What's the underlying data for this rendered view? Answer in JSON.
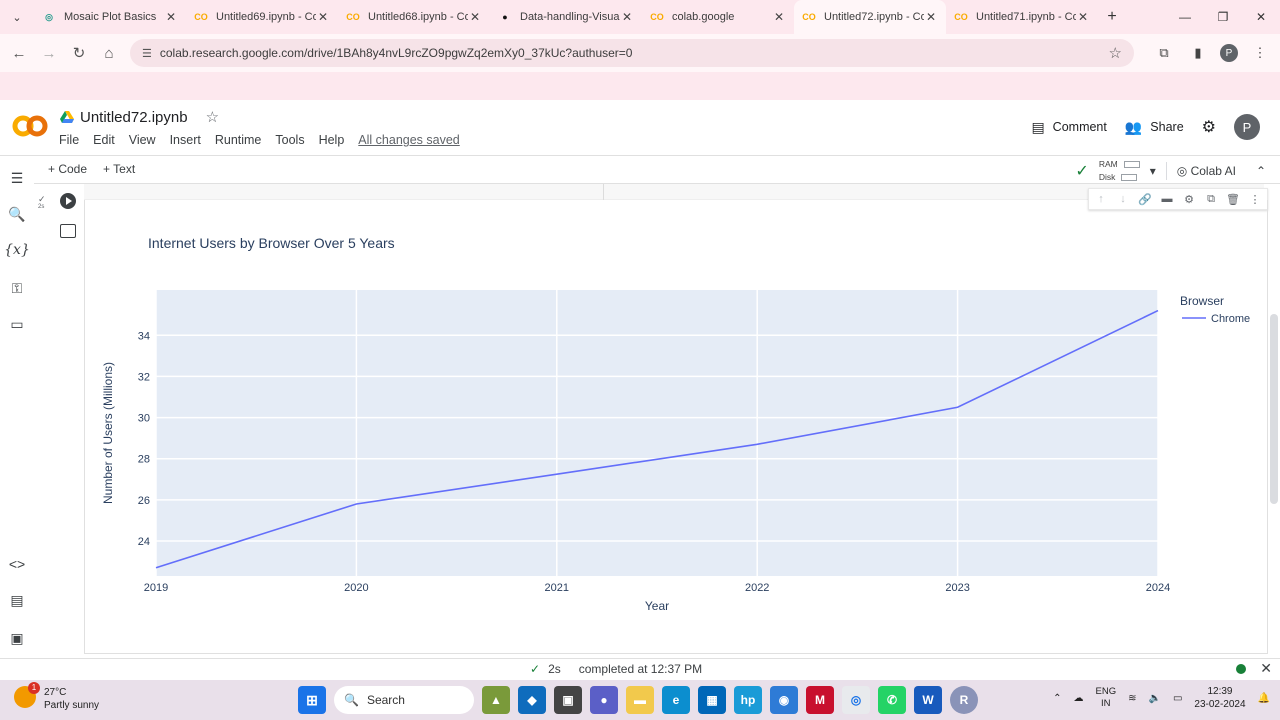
{
  "browser": {
    "tabs": [
      {
        "title": "Mosaic Plot Basics",
        "fav": "mosaic-icon",
        "active": false
      },
      {
        "title": "Untitled69.ipynb - Co",
        "fav": "colab-icon",
        "active": false
      },
      {
        "title": "Untitled68.ipynb - Co",
        "fav": "colab-icon",
        "active": false
      },
      {
        "title": "Data-handling-Visua",
        "fav": "github-icon",
        "active": false
      },
      {
        "title": "colab.google",
        "fav": "colab-icon",
        "active": false
      },
      {
        "title": "Untitled72.ipynb - Co",
        "fav": "colab-icon",
        "active": true
      },
      {
        "title": "Untitled71.ipynb - Co",
        "fav": "colab-icon",
        "active": false
      }
    ],
    "url": "colab.research.google.com/drive/1BAh8y4nvL9rcZO9pgwZq2emXy0_37kUc?authuser=0",
    "profile_initial": "P"
  },
  "colab": {
    "title": "Untitled72.ipynb",
    "menu": [
      "File",
      "Edit",
      "View",
      "Insert",
      "Runtime",
      "Tools",
      "Help"
    ],
    "saved_status": "All changes saved",
    "comment_label": "Comment",
    "share_label": "Share",
    "avatar_initial": "P",
    "toolbar": {
      "code_label": "+ Code",
      "text_label": "+ Text",
      "ram_label": "RAM",
      "disk_label": "Disk",
      "colab_ai_label": "Colab AI"
    },
    "cell_status": {
      "check": "✓",
      "time": "2s"
    }
  },
  "chart_data": {
    "type": "line",
    "title": "Internet Users by Browser Over 5 Years",
    "xlabel": "Year",
    "ylabel": "Number of Users (Millions)",
    "x": [
      2019,
      2020,
      2021,
      2022,
      2023,
      2024
    ],
    "series": [
      {
        "name": "Chrome",
        "color": "#636efa",
        "values": [
          22.7,
          25.8,
          27.25,
          28.7,
          30.5,
          35.2
        ]
      }
    ],
    "x_ticks": [
      "2019",
      "2020",
      "2021",
      "2022",
      "2023",
      "2024"
    ],
    "y_ticks": [
      24,
      26,
      28,
      30,
      32,
      34
    ],
    "xlim": [
      2019,
      2024
    ],
    "ylim": [
      22.3,
      36.2
    ],
    "legend_title": "Browser",
    "legend_position": "right",
    "plot_bg": "#e5ecf6",
    "grid": true
  },
  "status": {
    "elapsed": "2s",
    "completed": "completed at 12:37 PM"
  },
  "taskbar": {
    "temperature": "27°C",
    "weather": "Partly sunny",
    "weather_badge": "1",
    "search_label": "Search",
    "lang_line1": "ENG",
    "lang_line2": "IN",
    "time": "12:39",
    "date": "23-02-2024"
  }
}
